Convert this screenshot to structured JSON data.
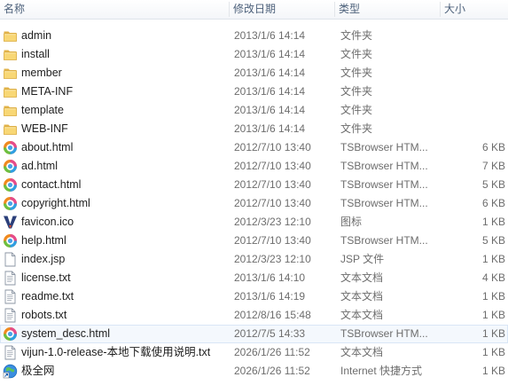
{
  "columns": {
    "name": "名称",
    "modified": "修改日期",
    "type": "类型",
    "size": "大小"
  },
  "files": [
    {
      "name": "admin",
      "modified": "2013/1/6 14:14",
      "type": "文件夹",
      "size": "",
      "icon": "folder-icon"
    },
    {
      "name": "install",
      "modified": "2013/1/6 14:14",
      "type": "文件夹",
      "size": "",
      "icon": "folder-icon"
    },
    {
      "name": "member",
      "modified": "2013/1/6 14:14",
      "type": "文件夹",
      "size": "",
      "icon": "folder-icon"
    },
    {
      "name": "META-INF",
      "modified": "2013/1/6 14:14",
      "type": "文件夹",
      "size": "",
      "icon": "folder-icon"
    },
    {
      "name": "template",
      "modified": "2013/1/6 14:14",
      "type": "文件夹",
      "size": "",
      "icon": "folder-icon"
    },
    {
      "name": "WEB-INF",
      "modified": "2013/1/6 14:14",
      "type": "文件夹",
      "size": "",
      "icon": "folder-icon"
    },
    {
      "name": "about.html",
      "modified": "2012/7/10 13:40",
      "type": "TSBrowser HTM...",
      "size": "6 KB",
      "icon": "browser-html-icon"
    },
    {
      "name": "ad.html",
      "modified": "2012/7/10 13:40",
      "type": "TSBrowser HTM...",
      "size": "7 KB",
      "icon": "browser-html-icon"
    },
    {
      "name": "contact.html",
      "modified": "2012/7/10 13:40",
      "type": "TSBrowser HTM...",
      "size": "5 KB",
      "icon": "browser-html-icon"
    },
    {
      "name": "copyright.html",
      "modified": "2012/7/10 13:40",
      "type": "TSBrowser HTM...",
      "size": "6 KB",
      "icon": "browser-html-icon"
    },
    {
      "name": "favicon.ico",
      "modified": "2012/3/23 12:10",
      "type": "图标",
      "size": "1 KB",
      "icon": "favicon-v-icon"
    },
    {
      "name": "help.html",
      "modified": "2012/7/10 13:40",
      "type": "TSBrowser HTM...",
      "size": "5 KB",
      "icon": "browser-html-icon"
    },
    {
      "name": "index.jsp",
      "modified": "2012/3/23 12:10",
      "type": "JSP 文件",
      "size": "1 KB",
      "icon": "blank-file-icon"
    },
    {
      "name": "license.txt",
      "modified": "2013/1/6 14:10",
      "type": "文本文档",
      "size": "4 KB",
      "icon": "text-file-icon"
    },
    {
      "name": "readme.txt",
      "modified": "2013/1/6 14:19",
      "type": "文本文档",
      "size": "1 KB",
      "icon": "text-file-icon"
    },
    {
      "name": "robots.txt",
      "modified": "2012/8/16 15:48",
      "type": "文本文档",
      "size": "1 KB",
      "icon": "text-file-icon"
    },
    {
      "name": "system_desc.html",
      "modified": "2012/7/5 14:33",
      "type": "TSBrowser HTM...",
      "size": "1 KB",
      "icon": "browser-html-icon",
      "selected": true
    },
    {
      "name": "vijun-1.0-release-本地下载使用说明.txt",
      "modified": "2026/1/26 11:52",
      "type": "文本文档",
      "size": "1 KB",
      "icon": "text-file-icon"
    },
    {
      "name": "极全网",
      "modified": "2026/1/26 11:52",
      "type": "Internet 快捷方式",
      "size": "1 KB",
      "icon": "internet-shortcut-icon"
    }
  ]
}
